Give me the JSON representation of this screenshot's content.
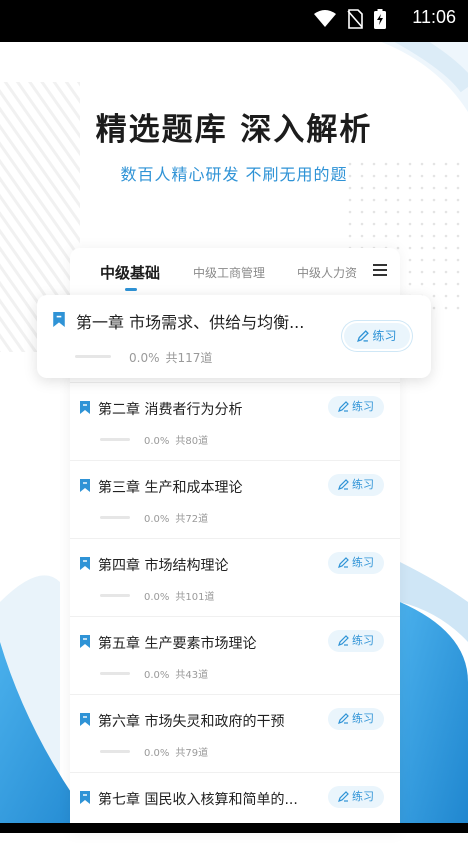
{
  "status_bar": {
    "time": "11:06",
    "icons": [
      "wifi-icon",
      "no-sim-icon",
      "battery-charging-icon"
    ]
  },
  "header": {
    "title": "精选题库 深入解析",
    "subtitle": "数百人精心研发 不刷无用的题"
  },
  "tabs": [
    {
      "label": "中级基础",
      "active": true
    },
    {
      "label": "中级工商管理",
      "active": false
    },
    {
      "label": "中级人力资",
      "active": false
    }
  ],
  "menu_icon": "menu-icon",
  "highlight": {
    "title": "第一章 市场需求、供给与均衡...",
    "progress": "0.0%",
    "total": "共117道",
    "button": "练习"
  },
  "chapters": [
    {
      "title": "第二章 消费者行为分析",
      "progress": "0.0%",
      "total": "共80道",
      "button": "练习"
    },
    {
      "title": "第三章 生产和成本理论",
      "progress": "0.0%",
      "total": "共72道",
      "button": "练习"
    },
    {
      "title": "第四章 市场结构理论",
      "progress": "0.0%",
      "total": "共101道",
      "button": "练习"
    },
    {
      "title": "第五章 生产要素市场理论",
      "progress": "0.0%",
      "total": "共43道",
      "button": "练习"
    },
    {
      "title": "第六章 市场失灵和政府的干预",
      "progress": "0.0%",
      "total": "共79道",
      "button": "练习"
    },
    {
      "title": "第七章 国民收入核算和简单的...",
      "progress": "",
      "total": "",
      "button": "练习"
    }
  ],
  "colors": {
    "accent": "#2f93d6",
    "accent_light": "#eaf5fc",
    "text": "#1c1c1c"
  }
}
